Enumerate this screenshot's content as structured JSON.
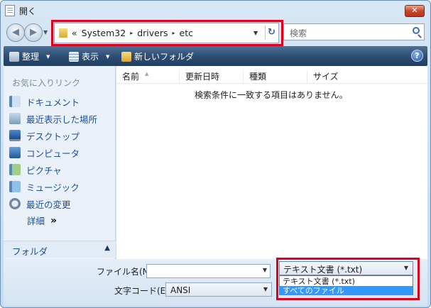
{
  "window": {
    "title": "開く",
    "close_glyph": "✕"
  },
  "nav": {
    "back_glyph": "◀",
    "forward_glyph": "▶",
    "dropdown_glyph": "▼"
  },
  "address": {
    "overflow_glyph": "«",
    "segments": [
      "System32",
      "drivers",
      "etc"
    ],
    "separator_glyph": "▸",
    "dropdown_glyph": "▼",
    "refresh_glyph": "↻"
  },
  "search": {
    "placeholder": "検索"
  },
  "toolbar": {
    "organize_label": "整理",
    "view_label": "表示",
    "new_folder_label": "新しいフォルダ",
    "arrow_glyph": "▼",
    "help_glyph": "?"
  },
  "sidebar": {
    "favorites_header": "お気に入りリンク",
    "items": [
      {
        "label": "ドキュメント",
        "icon": "documents-icon"
      },
      {
        "label": "最近表示した場所",
        "icon": "recent-places-icon"
      },
      {
        "label": "デスクトップ",
        "icon": "desktop-icon"
      },
      {
        "label": "コンピュータ",
        "icon": "computer-icon"
      },
      {
        "label": "ピクチャ",
        "icon": "pictures-icon"
      },
      {
        "label": "ミュージック",
        "icon": "music-icon"
      },
      {
        "label": "最近の変更",
        "icon": "recent-changes-icon"
      }
    ],
    "more_label": "詳細",
    "more_glyph": "»",
    "folders_label": "フォルダ",
    "folders_toggle_glyph": "▲"
  },
  "file_list": {
    "columns": [
      "名前",
      "更新日時",
      "種類",
      "サイズ"
    ],
    "sort_glyph": "▲",
    "empty_message": "検索条件に一致する項目はありません。"
  },
  "bottom": {
    "filename_label": "ファイル名(N):",
    "filename_value": "",
    "filename_dropdown_glyph": "▼",
    "encoding_label": "文字コード(E):",
    "encoding_value": "ANSI",
    "encoding_dropdown_glyph": "▼",
    "filetype_selected": "テキスト文書 (*.txt)",
    "filetype_dropdown_glyph": "▼",
    "filetype_options": [
      "テキスト文書 (*.txt)",
      "すべてのファイル"
    ],
    "filetype_highlighted_option": "すべてのファイル"
  },
  "colors": {
    "highlight_box": "#e0001a",
    "link_text": "#1a4f9c",
    "toolbar_bg": "#2f4e74",
    "selected_option_bg": "#3399ff"
  }
}
